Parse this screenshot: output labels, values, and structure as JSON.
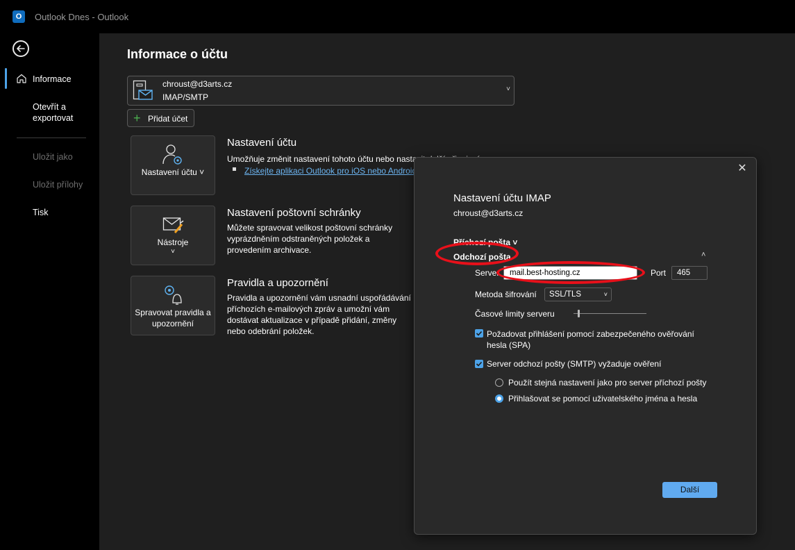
{
  "window": {
    "app_icon_letter": "O",
    "title": "Outlook Dnes  -  Outlook"
  },
  "sidebar": {
    "items": [
      {
        "label": "Informace",
        "active": true
      },
      {
        "label": "Otevřít a\nexportovat",
        "active": false
      },
      {
        "label": "Uložit jako",
        "disabled": true
      },
      {
        "label": "Uložit přílohy",
        "disabled": true
      },
      {
        "label": "Tisk",
        "disabled": false
      }
    ]
  },
  "main": {
    "title": "Informace o účtu",
    "account": {
      "email": "chroust@d3arts.cz",
      "type": "IMAP/SMTP"
    },
    "add_account_label": "Přidat účet",
    "sections": [
      {
        "tile_label": "Nastavení účtu ˅",
        "title": "Nastavení účtu",
        "desc": "Umožňuje změnit nastavení tohoto účtu nebo nastavit další připojení.",
        "link": "Získejte aplikaci Outlook pro iOS nebo Android."
      },
      {
        "tile_label": "Nástroje",
        "tile_sub": "˅",
        "title": "Nastavení poštovní schránky",
        "desc": "Můžete spravovat velikost poštovní schránky vyprázdněním odstraněných položek a provedením archivace."
      },
      {
        "tile_label": "Spravovat pravidla a upozornění",
        "title": "Pravidla a upozornění",
        "desc": "Pravidla a upozornění vám usnadní uspořádávání příchozích e-mailových zpráv a umožní vám dostávat aktualizace v případě přidání, změny nebo odebrání položek."
      }
    ]
  },
  "dialog": {
    "close_glyph": "✕",
    "title": "Nastavení účtu IMAP",
    "email": "chroust@d3arts.cz",
    "incoming_label": "Příchozí pošta ˅",
    "outgoing_label": "Odchozí pošta",
    "outgoing_caret": "˄",
    "server_label": "Server",
    "server_value": "mail.best-hosting.cz",
    "port_label": "Port",
    "port_value": "465",
    "encryption_label": "Metoda šifrování",
    "encryption_value": "SSL/TLS",
    "timeout_label": "Časové limity serveru",
    "timeout_level": 0.05,
    "spa_checkbox_label": "Požadovat přihlášení pomocí zabezpečeného ověřování\nhesla (SPA)",
    "spa_checked": true,
    "smtp_auth_label": "Server odchozí pošty (SMTP) vyžaduje ověření",
    "smtp_auth_checked": true,
    "radio_same_settings": "Použít stejná nastavení jako pro server příchozí pošty",
    "radio_login": "Přihlašovat se pomocí uživatelského jména a hesla",
    "selected_radio": "login",
    "next_button": "Další"
  },
  "colors": {
    "accent": "#4da3e8",
    "annotation": "#e8101a",
    "link": "#6cb4f0"
  }
}
